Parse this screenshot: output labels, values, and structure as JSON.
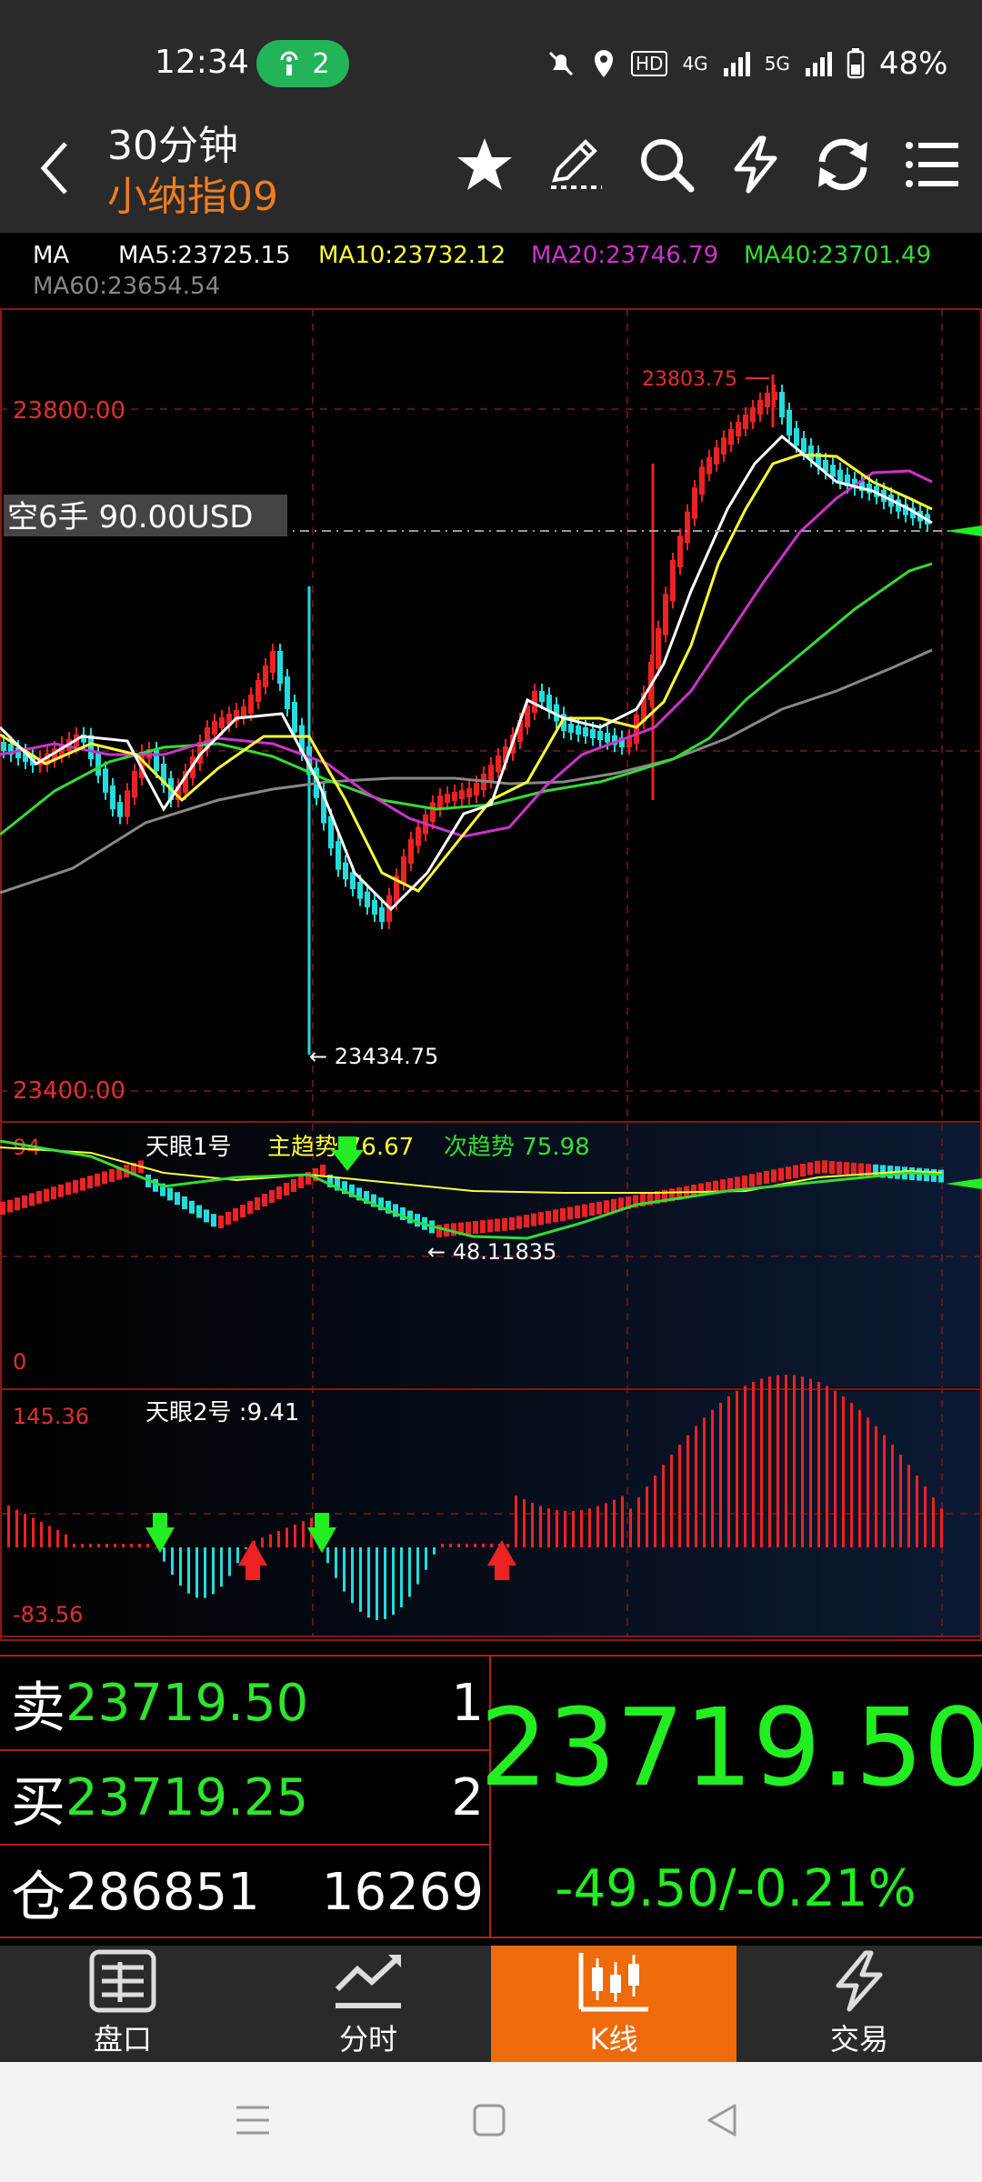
{
  "status": {
    "time": "12:34",
    "hotspot_count": "2",
    "battery": "48%",
    "network_1": "4G",
    "network_2": "5G",
    "hd_badge": "HD"
  },
  "header": {
    "title": "30分钟",
    "subtitle": "小纳指09"
  },
  "ma_legend": {
    "label": "MA",
    "ma5": "MA5:23725.15",
    "ma10": "MA10:23732.12",
    "ma20": "MA20:23746.79",
    "ma40": "MA40:23701.49",
    "ma60": "MA60:23654.54",
    "colors": {
      "ma5": "#ffffff",
      "ma10": "#ffff33",
      "ma20": "#cc33cc",
      "ma40": "#33dd33",
      "ma60": "#888888"
    }
  },
  "main_chart": {
    "price_high_label": "23800.00",
    "price_low_label": "23400.00",
    "max_marker": "23803.75",
    "min_marker": "← 23434.75",
    "position_label": "空6手  90.00USD"
  },
  "indicator1": {
    "name": "天眼1号",
    "main_trend": "主趋势:76.67",
    "sub_trend": "次趋势 75.98",
    "top_label": "94",
    "bottom_label": "0",
    "min_marker": "← 48.11835"
  },
  "indicator2": {
    "name": "天眼2号 :9.41",
    "top_label": "145.36",
    "bottom_label": "-83.56"
  },
  "quote": {
    "sell_label": "卖",
    "sell_price": "23719.50",
    "sell_qty": "1",
    "buy_label": "买",
    "buy_price": "23719.25",
    "buy_qty": "2",
    "oi_label": "仓",
    "open_interest": "286851",
    "volume": "16269",
    "last_price": "23719.50",
    "change": "-49.50/-0.21%"
  },
  "tabs": [
    {
      "label": "盘口",
      "icon": "orderbook-icon"
    },
    {
      "label": "分时",
      "icon": "timeshare-icon"
    },
    {
      "label": "K线",
      "icon": "candlestick-icon",
      "active": true
    },
    {
      "label": "交易",
      "icon": "lightning-icon"
    }
  ],
  "colors": {
    "accent": "#f07c1e",
    "up": "#ee2222",
    "down": "#22dddd",
    "price_green": "#22ee22"
  }
}
